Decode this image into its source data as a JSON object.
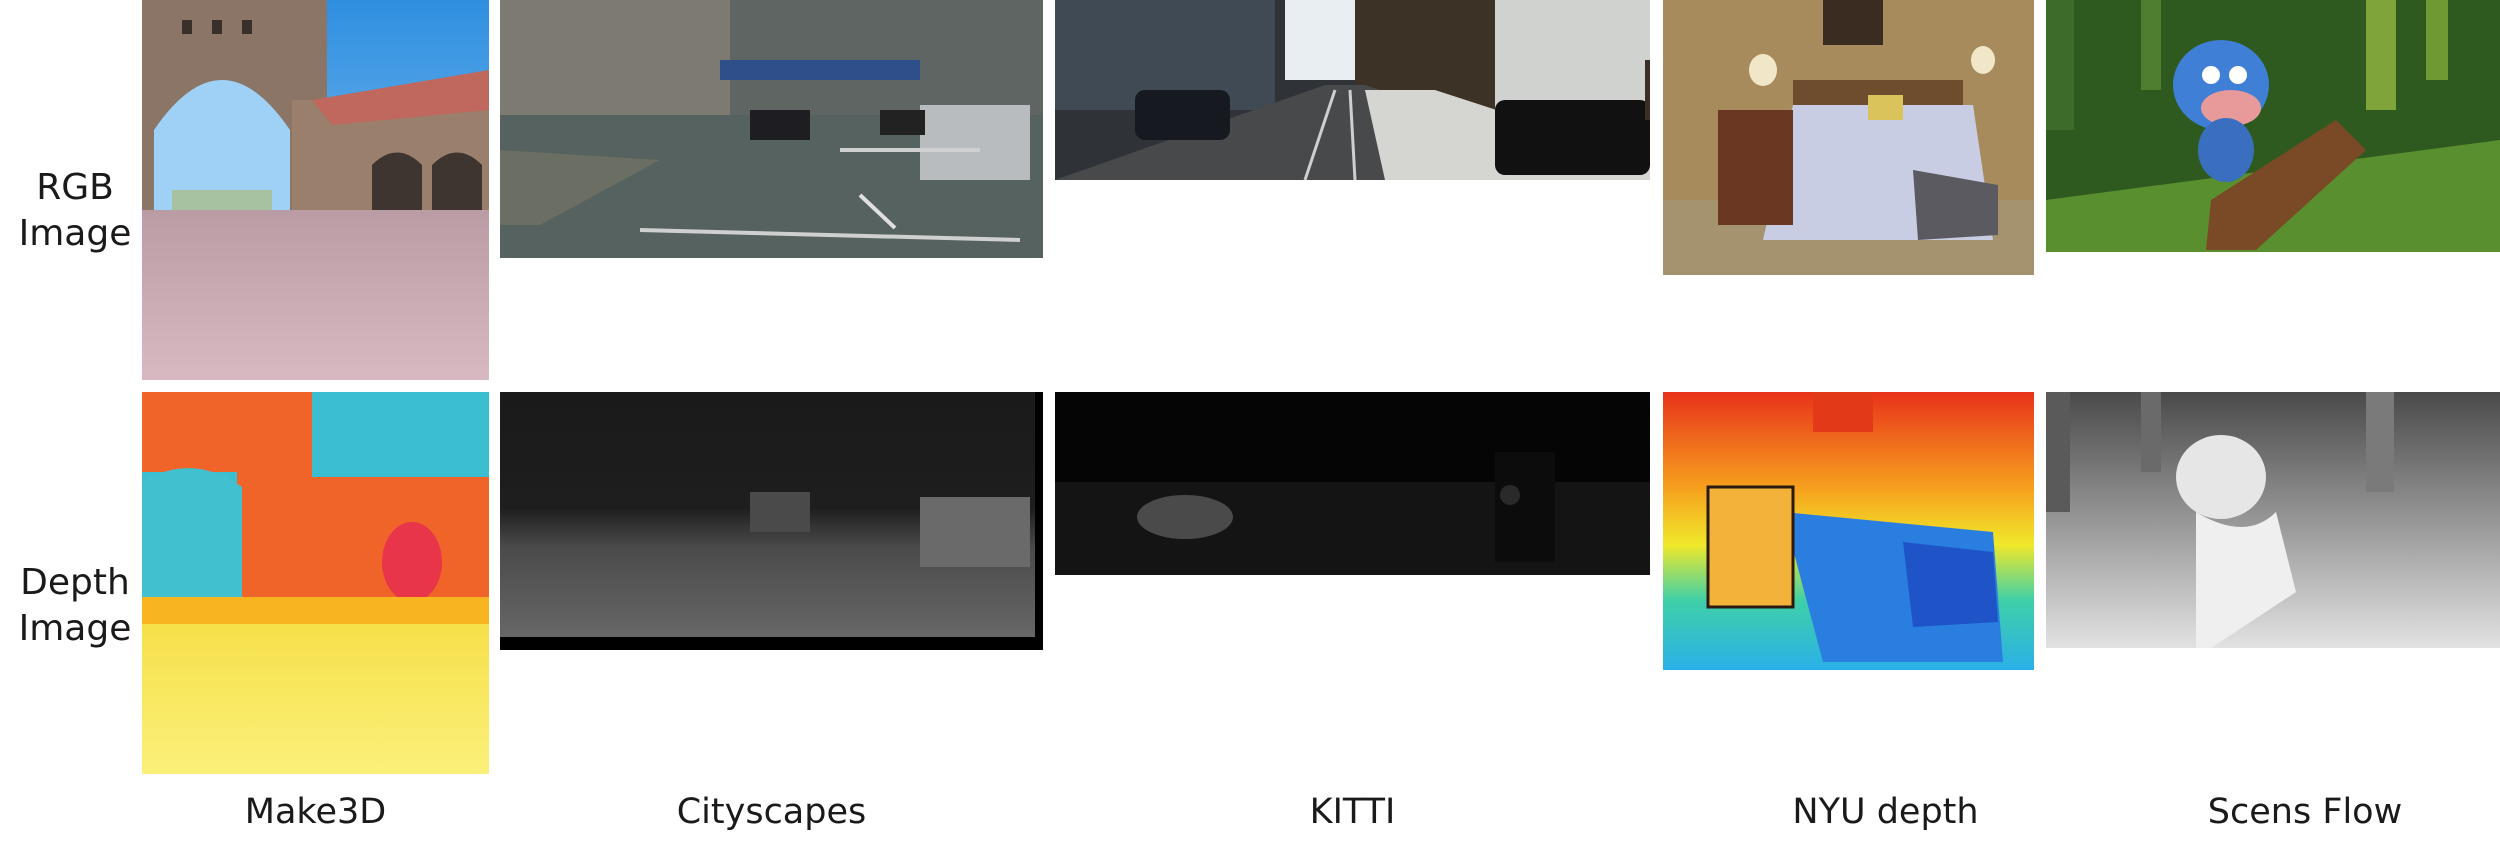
{
  "rows": {
    "rgb": "RGB\nImage",
    "depth": "Depth\nImage"
  },
  "datasets": [
    {
      "key": "make3d",
      "label": "Make3D"
    },
    {
      "key": "cityscapes",
      "label": "Cityscapes"
    },
    {
      "key": "kitti",
      "label": "KITTI"
    },
    {
      "key": "nyu",
      "label": "NYU depth"
    },
    {
      "key": "sceneflow",
      "label": "Scens Flow"
    }
  ]
}
